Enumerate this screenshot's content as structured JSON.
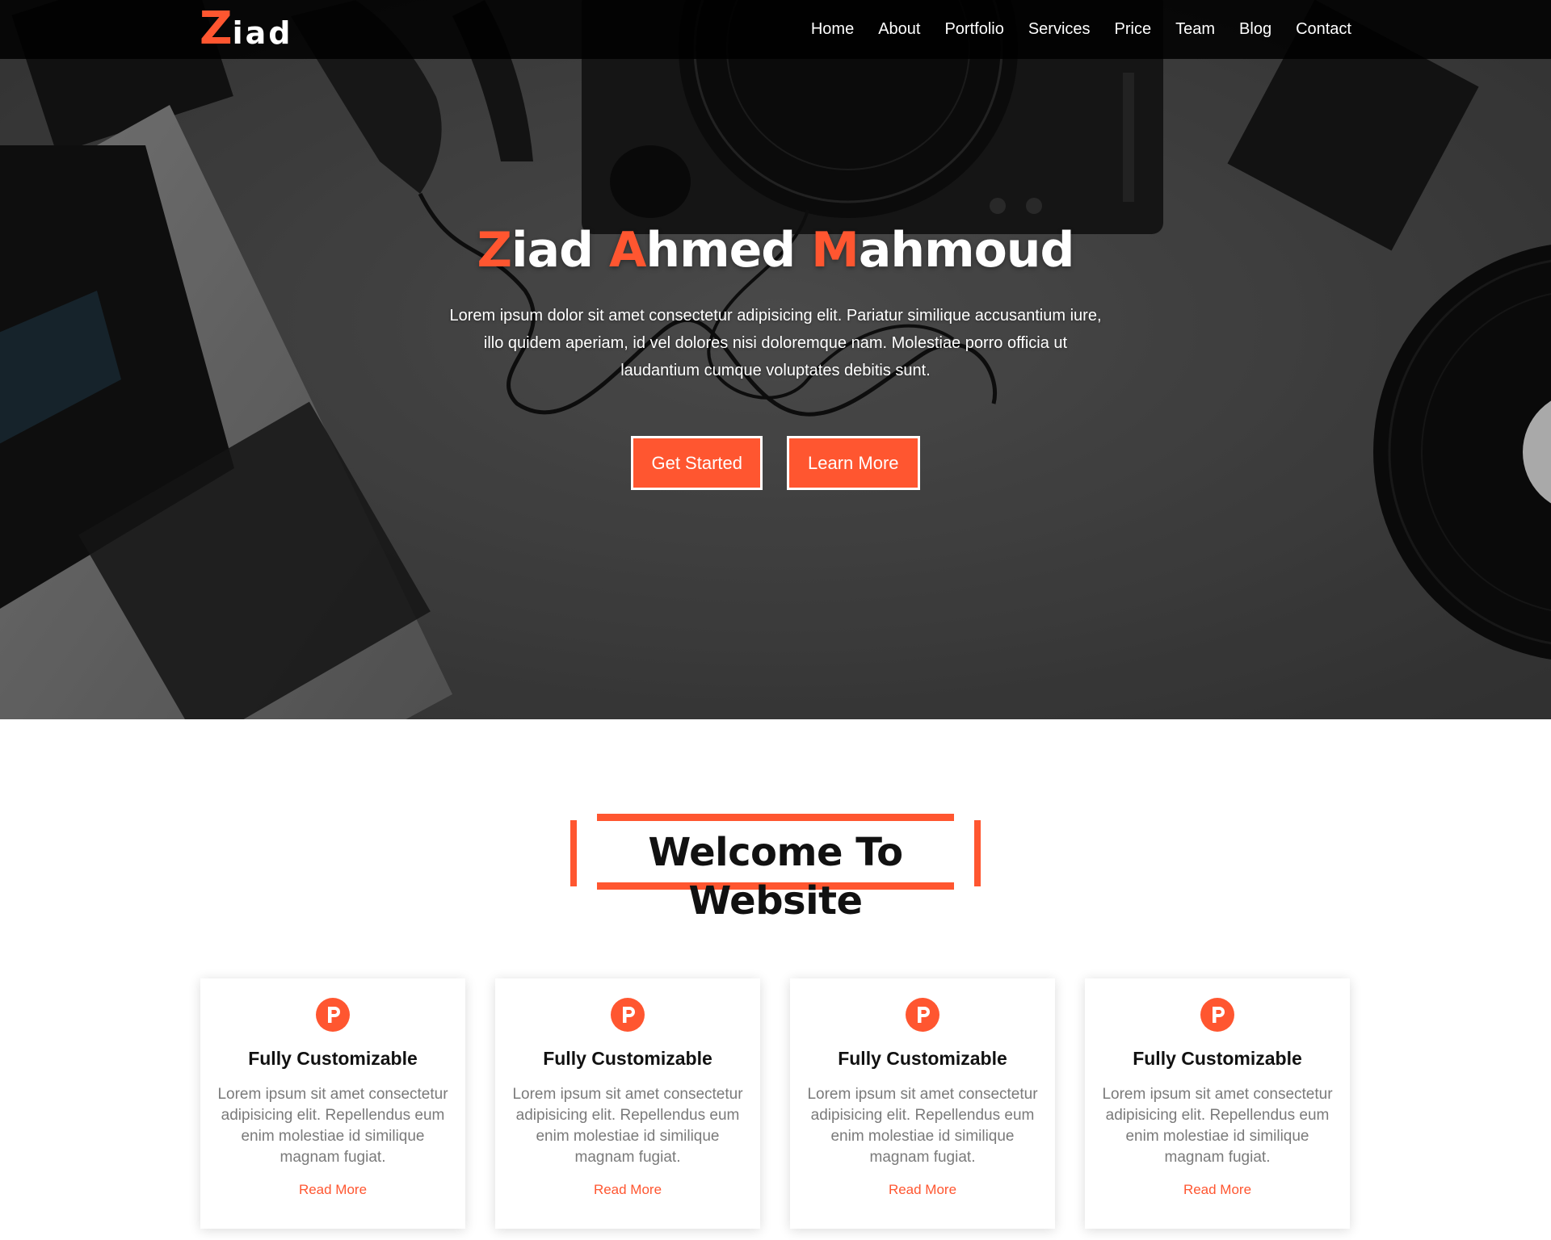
{
  "brand": {
    "logo_first": "Z",
    "logo_rest": "iad",
    "accent_color": "#ff5630"
  },
  "nav": {
    "items": [
      "Home",
      "About",
      "Portfolio",
      "Services",
      "Price",
      "Team",
      "Blog",
      "Contact"
    ]
  },
  "hero": {
    "title_parts": [
      {
        "text": "Z",
        "accent": true
      },
      {
        "text": "iad ",
        "accent": false
      },
      {
        "text": "A",
        "accent": true
      },
      {
        "text": "hmed ",
        "accent": false
      },
      {
        "text": "M",
        "accent": true
      },
      {
        "text": "ahmoud",
        "accent": false
      }
    ],
    "text_lines": [
      "Lorem ipsum dolor sit amet consectetur adipisicing elit. Pariatur similique accusantium iure,",
      "illo quidem aperiam, id vel dolores nisi doloremque nam. Molestiae porro officia ut",
      "laudantium cumque voluptates debitis sunt."
    ],
    "primary_button": "Get Started",
    "secondary_button": "Learn More"
  },
  "welcome": {
    "title": "Welcome To Website"
  },
  "features": [
    {
      "icon": "product-hunt-icon",
      "title": "Fully Customizable",
      "text": "Lorem ipsum sit amet consectetur adipisicing elit. Repellendus eum enim molestiae id similique magnam fugiat.",
      "link": "Read More"
    },
    {
      "icon": "product-hunt-icon",
      "title": "Fully Customizable",
      "text": "Lorem ipsum sit amet consectetur adipisicing elit. Repellendus eum enim molestiae id similique magnam fugiat.",
      "link": "Read More"
    },
    {
      "icon": "product-hunt-icon",
      "title": "Fully Customizable",
      "text": "Lorem ipsum sit amet consectetur adipisicing elit. Repellendus eum enim molestiae id similique magnam fugiat.",
      "link": "Read More"
    },
    {
      "icon": "product-hunt-icon",
      "title": "Fully Customizable",
      "text": "Lorem ipsum sit amet consectetur adipisicing elit. Repellendus eum enim molestiae id similique magnam fugiat.",
      "link": "Read More"
    }
  ]
}
